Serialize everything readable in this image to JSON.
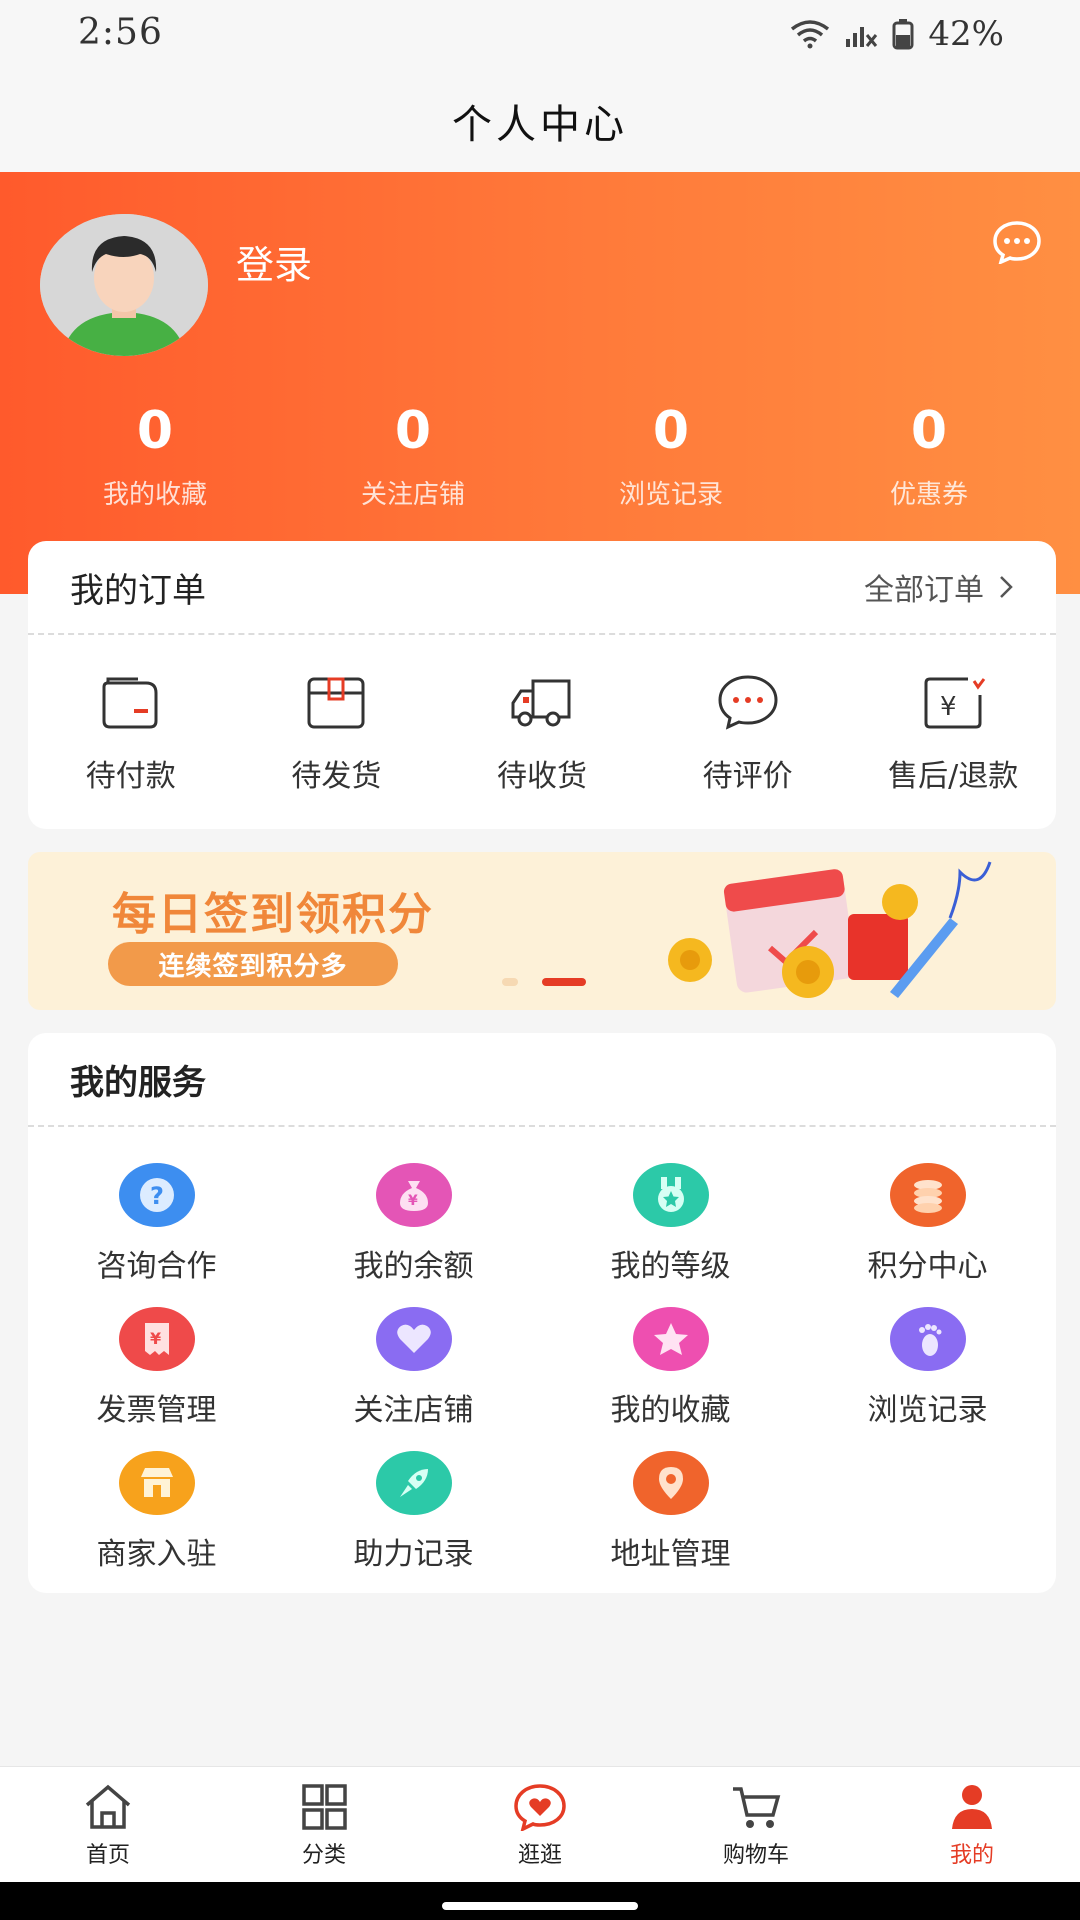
{
  "status_bar": {
    "time": "2:56",
    "battery": "42%"
  },
  "header": {
    "title": "个人中心"
  },
  "profile": {
    "login_label": "登录"
  },
  "stats": [
    {
      "value": "0",
      "label": "我的收藏"
    },
    {
      "value": "0",
      "label": "关注店铺"
    },
    {
      "value": "0",
      "label": "浏览记录"
    },
    {
      "value": "0",
      "label": "优惠券"
    }
  ],
  "orders": {
    "title": "我的订单",
    "all_label": "全部订单",
    "items": [
      {
        "label": "待付款",
        "icon": "wallet-icon"
      },
      {
        "label": "待发货",
        "icon": "package-icon"
      },
      {
        "label": "待收货",
        "icon": "truck-icon"
      },
      {
        "label": "待评价",
        "icon": "chat-bubble-icon"
      },
      {
        "label": "售后/退款",
        "icon": "refund-icon"
      }
    ]
  },
  "banner": {
    "title": "每日签到领积分",
    "subtitle": "连续签到积分多"
  },
  "services": {
    "title": "我的服务",
    "items": [
      {
        "label": "咨询合作",
        "icon": "question-icon",
        "color": "#3d8ef0"
      },
      {
        "label": "我的余额",
        "icon": "money-bag-icon",
        "color": "#e455b6"
      },
      {
        "label": "我的等级",
        "icon": "medal-icon",
        "color": "#2cc9a8"
      },
      {
        "label": "积分中心",
        "icon": "coins-icon",
        "color": "#f0642c"
      },
      {
        "label": "发票管理",
        "icon": "invoice-icon",
        "color": "#ef4a4a"
      },
      {
        "label": "关注店铺",
        "icon": "heart-icon",
        "color": "#8a6cf2"
      },
      {
        "label": "我的收藏",
        "icon": "star-icon",
        "color": "#ee4fb0"
      },
      {
        "label": "浏览记录",
        "icon": "footprint-icon",
        "color": "#8a6cf2"
      },
      {
        "label": "商家入驻",
        "icon": "shop-icon",
        "color": "#f7a21c"
      },
      {
        "label": "助力记录",
        "icon": "rocket-icon",
        "color": "#2cc9a8"
      },
      {
        "label": "地址管理",
        "icon": "location-pin-icon",
        "color": "#f0642c"
      }
    ]
  },
  "tabs": [
    {
      "label": "首页",
      "icon": "home-icon"
    },
    {
      "label": "分类",
      "icon": "grid-icon"
    },
    {
      "label": "逛逛",
      "icon": "heart-chat-icon"
    },
    {
      "label": "购物车",
      "icon": "cart-icon"
    },
    {
      "label": "我的",
      "icon": "person-icon",
      "active": true
    }
  ],
  "colors": {
    "accent": "#e53c25",
    "banner_start": "#ff5a2c",
    "banner_end": "#ff8f42"
  }
}
